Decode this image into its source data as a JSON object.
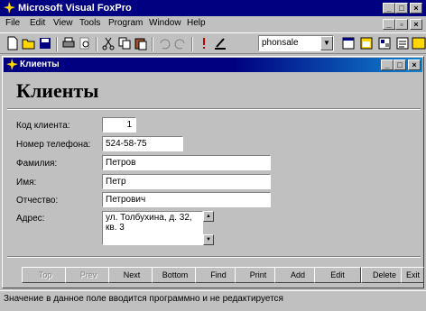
{
  "app": {
    "title": "Microsoft Visual FoxPro"
  },
  "menu": [
    "File",
    "Edit",
    "View",
    "Tools",
    "Program",
    "Window",
    "Help"
  ],
  "toolbar": {
    "database_combo": "phonsale"
  },
  "form": {
    "window_title": "Клиенты",
    "heading": "Клиенты",
    "fields": {
      "client_code": {
        "label": "Код клиента:",
        "value": "1"
      },
      "phone": {
        "label": "Номер телефона:",
        "value": "524-58-75"
      },
      "last_name": {
        "label": "Фамилия:",
        "value": "Петров"
      },
      "first_name": {
        "label": "Имя:",
        "value": "Петр"
      },
      "patronymic": {
        "label": "Отчество:",
        "value": "Петрович"
      },
      "address": {
        "label": "Адрес:",
        "value": "ул. Толбухина, д. 32, кв. 3"
      }
    },
    "buttons": {
      "top": "Top",
      "prev": "Prev",
      "next": "Next",
      "bottom": "Bottom",
      "find": "Find",
      "print": "Print",
      "add": "Add",
      "edit": "Edit",
      "delete": "Delete",
      "exit": "Exit"
    }
  },
  "status_bar": {
    "text": "Значение в данное поле вводится программно и не редактируется"
  }
}
